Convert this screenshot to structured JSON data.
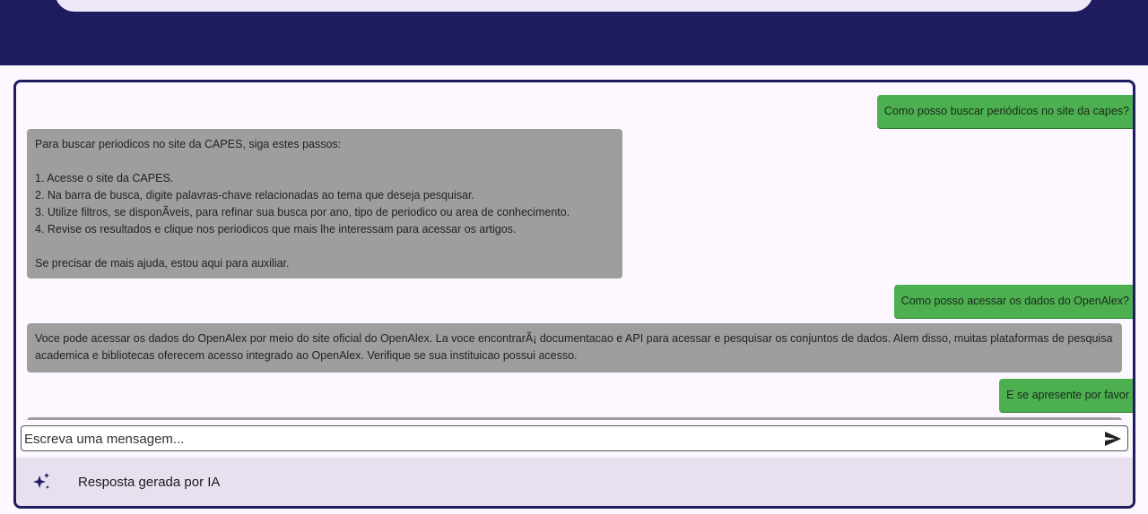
{
  "chat": {
    "messages": [
      {
        "role": "user",
        "text": "Como posso buscar periódicos no site da capes?"
      },
      {
        "role": "assistant",
        "lines": [
          "Para buscar periodicos no site da CAPES, siga estes passos:",
          "",
          "1. Acesse o site da CAPES.",
          "2. Na barra de busca, digite palavras-chave relacionadas ao tema que deseja pesquisar.",
          "3. Utilize filtros, se disponÃveis, para refinar sua busca por ano, tipo de periodico ou area de conhecimento.",
          "4. Revise os resultados e clique nos periodicos que mais lhe interessam para acessar os artigos.",
          "",
          "Se precisar de mais ajuda, estou aqui para auxiliar."
        ]
      },
      {
        "role": "user",
        "text": "Como posso acessar os dados do OpenAlex?"
      },
      {
        "role": "assistant",
        "lines": [
          "Voce pode acessar os dados do OpenAlex por meio do site oficial do OpenAlex. La voce encontrarÃ¡ documentacao e API para acessar e pesquisar os conjuntos de dados. Alem disso, muitas plataformas de pesquisa academica e bibliotecas oferecem acesso integrado ao OpenAlex. Verifique se sua instituicao possui acesso."
        ]
      },
      {
        "role": "user",
        "text": "E se apresente por favor"
      }
    ]
  },
  "input": {
    "placeholder": "Escreva uma mensagem..."
  },
  "footer": {
    "label": "Resposta gerada por IA",
    "icon": "sparkle-icon"
  },
  "colors": {
    "header": "#1e1b5e",
    "user_bubble": "#4caf50",
    "assistant_bubble": "#9e9e9e",
    "footer_bg": "#e8e0ee"
  }
}
